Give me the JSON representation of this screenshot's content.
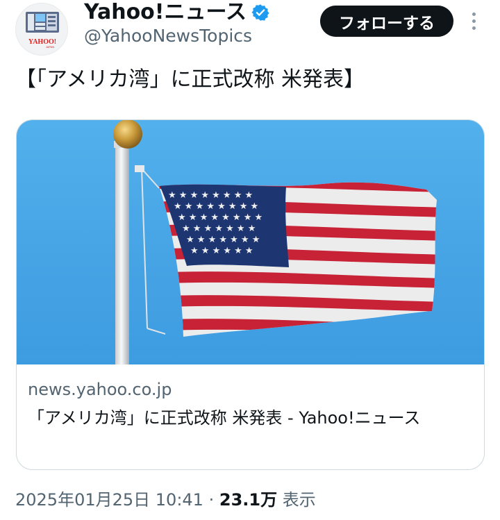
{
  "author": {
    "display_name": "Yahoo!ニュース",
    "handle": "@YahooNewsTopics",
    "avatar_logo_text": "YAHOO! JAPAN",
    "verified": true
  },
  "actions": {
    "follow_label": "フォローする",
    "more_icon": "more-vertical-icon"
  },
  "tweet": {
    "text": "【「アメリカ湾」に正式改称 米発表】"
  },
  "link_card": {
    "image_description": "american-flag-on-flagpole",
    "domain": "news.yahoo.co.jp",
    "title": "「アメリカ湾」に正式改称 米発表 - Yahoo!ニュース"
  },
  "meta": {
    "timestamp": "2025年01月25日 10:41",
    "separator": "·",
    "views_count": "23.1万",
    "views_label": "表示"
  },
  "colors": {
    "text_primary": "#0f1419",
    "text_secondary": "#536471",
    "follow_button_bg": "#0f1419",
    "verified_blue": "#1d9bf0",
    "card_border": "#cfd9de",
    "sky_blue": "#4aa9e8",
    "flag_red": "#d4253a",
    "flag_blue": "#1f3a7a"
  }
}
